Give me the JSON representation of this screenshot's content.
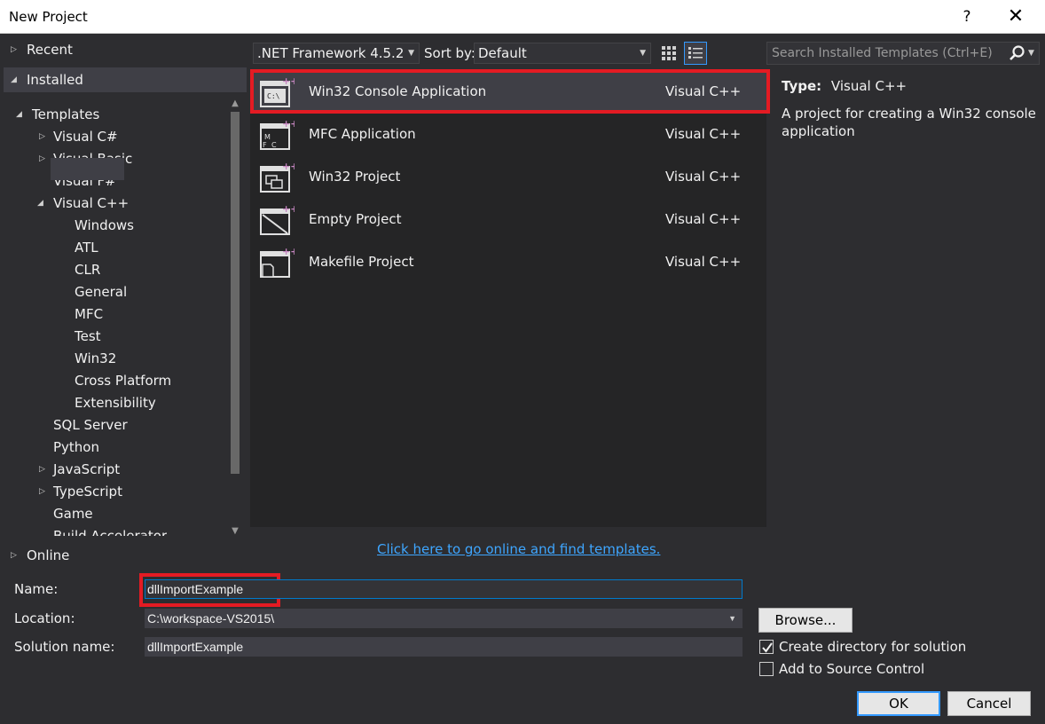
{
  "window": {
    "title": "New Project",
    "help_glyph": "?",
    "close_glyph": "✕"
  },
  "tree": {
    "recent": "Recent",
    "installed": "Installed",
    "templates": "Templates",
    "visual_csharp": "Visual C#",
    "visual_basic": "Visual Basic",
    "visual_fsharp": "Visual F#",
    "visual_cpp": "Visual C++",
    "cpp_children": [
      "Windows",
      "ATL",
      "CLR",
      "General",
      "MFC",
      "Test",
      "Win32",
      "Cross Platform",
      "Extensibility"
    ],
    "sql_server": "SQL Server",
    "python": "Python",
    "javascript": "JavaScript",
    "typescript": "TypeScript",
    "game": "Game",
    "build_accelerator_partial": "Build Accelerator",
    "online": "Online"
  },
  "toolbar": {
    "framework": ".NET Framework 4.5.2",
    "sort_label": "Sort by:",
    "sort_value": "Default"
  },
  "search": {
    "placeholder": "Search Installed Templates (Ctrl+E)"
  },
  "templates": [
    {
      "name": "Win32 Console Application",
      "lang": "Visual C++",
      "icon": "console-app-icon"
    },
    {
      "name": "MFC Application",
      "lang": "Visual C++",
      "icon": "mfc-app-icon"
    },
    {
      "name": "Win32 Project",
      "lang": "Visual C++",
      "icon": "win32-project-icon"
    },
    {
      "name": "Empty Project",
      "lang": "Visual C++",
      "icon": "empty-project-icon"
    },
    {
      "name": "Makefile Project",
      "lang": "Visual C++",
      "icon": "makefile-project-icon"
    }
  ],
  "details": {
    "type_label": "Type:",
    "type_value": "Visual C++",
    "description": "A project for creating a Win32 console application"
  },
  "online_link": "Click here to go online and find templates.",
  "form": {
    "name_label": "Name:",
    "name_value": "dllImportExample",
    "location_label": "Location:",
    "location_value": "C:\\workspace-VS2015\\",
    "solution_label": "Solution name:",
    "solution_value": "dllImportExample",
    "browse": "Browse...",
    "create_dir": "Create directory for solution",
    "create_dir_checked": true,
    "add_source": "Add to Source Control",
    "add_source_checked": false,
    "ok": "OK",
    "cancel": "Cancel"
  },
  "colors": {
    "background": "#2d2d30",
    "panel": "#252526",
    "selection": "#3f3f46",
    "accent": "#3399ff",
    "highlight_box": "#e41b23",
    "link": "#3ea6ff"
  }
}
